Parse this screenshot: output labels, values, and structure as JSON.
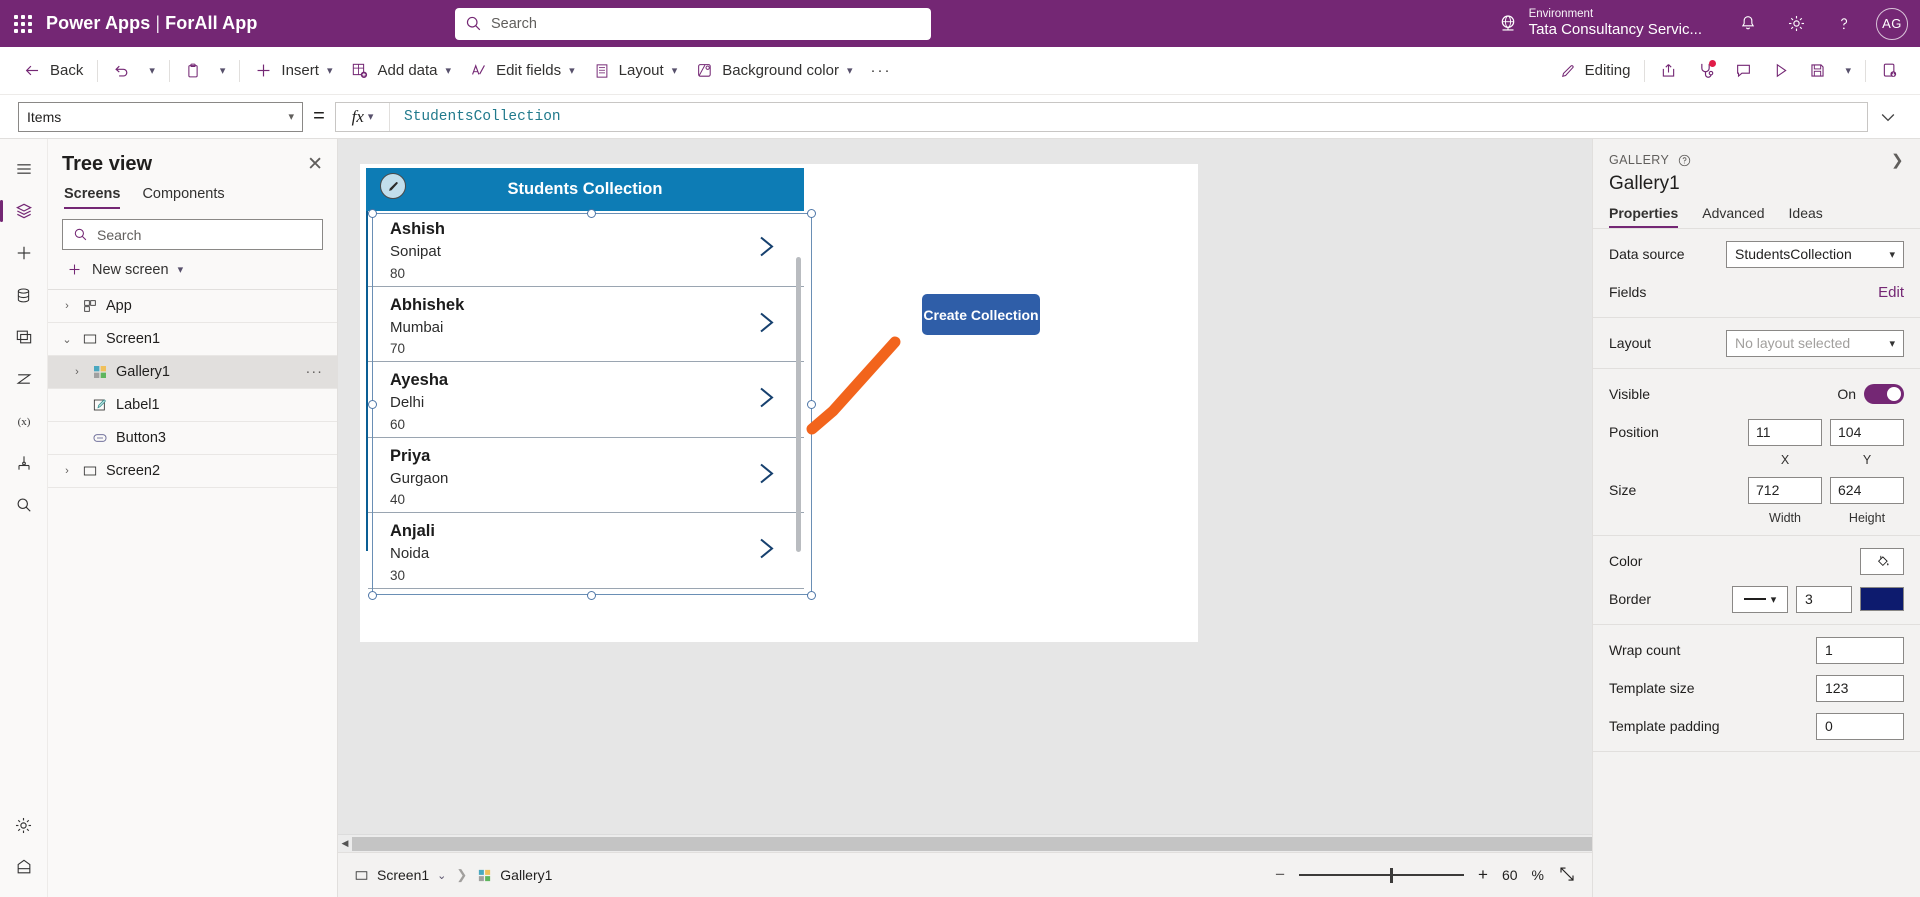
{
  "topbar": {
    "waffle_icon": "app-launcher-icon",
    "brand": "Power Apps",
    "brand_separator": "|",
    "app_name": "ForAll App",
    "search_placeholder": "Search",
    "environment_label": "Environment",
    "environment_name": "Tata Consultancy Servic...",
    "icons": [
      "globe-icon",
      "bell-icon",
      "gear-icon",
      "help-icon"
    ],
    "avatar_initials": "AG",
    "brand_color": "#742774"
  },
  "commandbar": {
    "back": "Back",
    "undo_icon": "undo-icon",
    "paste_icon": "paste-icon",
    "insert": "Insert",
    "add_data": "Add data",
    "edit_fields": "Edit fields",
    "layout": "Layout",
    "background_color": "Background color",
    "overflow": "···",
    "editing": "Editing",
    "right_icons": [
      "share-icon",
      "app-checker-icon",
      "comments-icon",
      "preview-icon",
      "save-icon",
      "chevron-down-icon",
      "publish-icon"
    ]
  },
  "formulabar": {
    "property": "Items",
    "equals": "=",
    "fx_label": "fx",
    "formula": "StudentsCollection",
    "expand_icon": "chevron-down-icon"
  },
  "rail": {
    "items": [
      {
        "name": "menu-icon"
      },
      {
        "name": "tree-view-icon"
      },
      {
        "name": "insert-icon"
      },
      {
        "name": "data-icon"
      },
      {
        "name": "media-icon"
      },
      {
        "name": "power-automate-icon"
      },
      {
        "name": "variables-icon"
      },
      {
        "name": "components-icon"
      },
      {
        "name": "search-icon"
      },
      {
        "name": "settings-icon"
      },
      {
        "name": "apps-icon"
      }
    ]
  },
  "treeview": {
    "title": "Tree view",
    "close_icon": "close-icon",
    "tabs": [
      {
        "label": "Screens",
        "selected": true
      },
      {
        "label": "Components",
        "selected": false
      }
    ],
    "search_placeholder": "Search",
    "new_screen": "New screen",
    "nodes": [
      {
        "label": "App",
        "indent": 0,
        "icon": "app-icon",
        "expander": "›",
        "selected": false,
        "more": ""
      },
      {
        "label": "Screen1",
        "indent": 0,
        "icon": "screen-icon",
        "expander": "⌄",
        "selected": false,
        "more": ""
      },
      {
        "label": "Gallery1",
        "indent": 1,
        "icon": "gallery-icon",
        "expander": "›",
        "selected": true,
        "more": "···"
      },
      {
        "label": "Label1",
        "indent": 2,
        "icon": "label-icon",
        "expander": "",
        "selected": false,
        "more": ""
      },
      {
        "label": "Button3",
        "indent": 2,
        "icon": "button-icon",
        "expander": "",
        "selected": false,
        "more": ""
      },
      {
        "label": "Screen2",
        "indent": 0,
        "icon": "screen-icon",
        "expander": "›",
        "selected": false,
        "more": ""
      }
    ]
  },
  "canvas": {
    "gallery_title": "Students Collection",
    "gallery_title_bg": "#0d7cb5",
    "items": [
      {
        "name": "Ashish",
        "city": "Sonipat",
        "score": "80"
      },
      {
        "name": "Abhishek",
        "city": "Mumbai",
        "score": "70"
      },
      {
        "name": "Ayesha",
        "city": "Delhi",
        "score": "60"
      },
      {
        "name": "Priya",
        "city": "Gurgaon",
        "score": "40"
      },
      {
        "name": "Anjali",
        "city": "Noida",
        "score": "30"
      }
    ],
    "chevron_icon": "chevron-right-icon",
    "edit_badge_icon": "pencil-icon",
    "create_button": "Create Collection",
    "create_button_color": "#2f5ea8"
  },
  "properties": {
    "kicker": "GALLERY",
    "help_icon": "help-circle-icon",
    "collapse_icon": "chevron-right-icon",
    "control_name": "Gallery1",
    "tabs": [
      {
        "label": "Properties",
        "selected": true
      },
      {
        "label": "Advanced",
        "selected": false
      },
      {
        "label": "Ideas",
        "selected": false
      }
    ],
    "data_source_label": "Data source",
    "data_source_value": "StudentsCollection",
    "fields_label": "Fields",
    "fields_action": "Edit",
    "layout_label": "Layout",
    "layout_value": "No layout selected",
    "visible_label": "Visible",
    "visible_state": "On",
    "position_label": "Position",
    "position_x": "11",
    "position_y": "104",
    "position_x_sub": "X",
    "position_y_sub": "Y",
    "size_label": "Size",
    "size_width": "712",
    "size_height": "624",
    "size_width_sub": "Width",
    "size_height_sub": "Height",
    "color_label": "Color",
    "color_icon": "fill-bucket-icon",
    "border_label": "Border",
    "border_width": "3",
    "border_color": "#0d1b6e",
    "wrap_count_label": "Wrap count",
    "wrap_count_value": "1",
    "template_size_label": "Template size",
    "template_size_value": "123",
    "template_padding_label": "Template padding",
    "template_padding_value": "0"
  },
  "statusbar": {
    "screen": "Screen1",
    "screen_chevron": "⌄",
    "control": "Gallery1",
    "zoom_minus": "−",
    "zoom_plus": "+",
    "zoom_value": "60",
    "zoom_unit": "%",
    "fullscreen_icon": "expand-icon"
  }
}
